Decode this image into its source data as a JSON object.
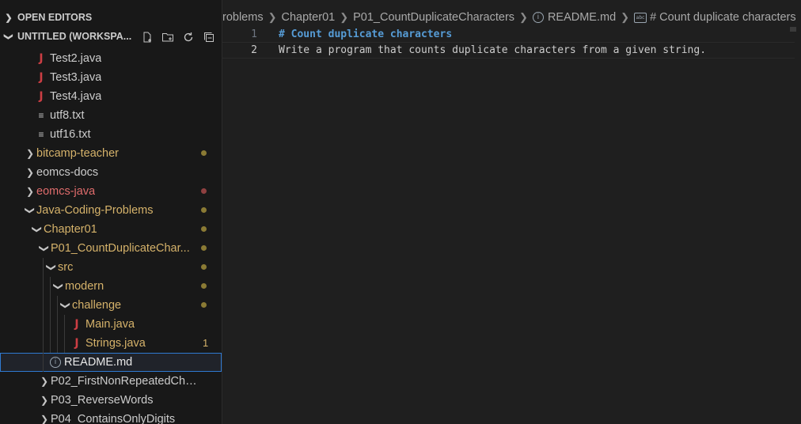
{
  "sidebar": {
    "open_editors_label": "OPEN EDITORS",
    "workspace_label": "UNTITLED (WORKSPA...",
    "items": [
      {
        "label": "Test2.java",
        "icon": "java",
        "indent": 1,
        "color": "plain"
      },
      {
        "label": "Test3.java",
        "icon": "java",
        "indent": 1,
        "color": "plain"
      },
      {
        "label": "Test4.java",
        "icon": "java",
        "indent": 1,
        "color": "plain"
      },
      {
        "label": "utf8.txt",
        "icon": "text",
        "indent": 1,
        "color": "plain"
      },
      {
        "label": "utf16.txt",
        "icon": "text",
        "indent": 1,
        "color": "plain"
      },
      {
        "label": "bitcamp-teacher",
        "icon": "chevron-right",
        "indent": 0,
        "color": "mod",
        "status": "dot"
      },
      {
        "label": "eomcs-docs",
        "icon": "chevron-right",
        "indent": 0,
        "color": "plain"
      },
      {
        "label": "eomcs-java",
        "icon": "chevron-right",
        "indent": 0,
        "color": "err",
        "status": "dot-error"
      },
      {
        "label": "Java-Coding-Problems",
        "icon": "chevron-down",
        "indent": 0,
        "color": "mod",
        "status": "dot"
      },
      {
        "label": "Chapter01",
        "icon": "chevron-down",
        "indent": 1,
        "color": "mod",
        "status": "dot"
      },
      {
        "label": "P01_CountDuplicateChar...",
        "icon": "chevron-down",
        "indent": 2,
        "color": "mod",
        "status": "dot"
      },
      {
        "label": "src",
        "icon": "chevron-down",
        "indent": 3,
        "color": "mod",
        "status": "dot"
      },
      {
        "label": "modern",
        "icon": "chevron-down",
        "indent": 4,
        "color": "mod",
        "status": "dot"
      },
      {
        "label": "challenge",
        "icon": "chevron-down",
        "indent": 5,
        "color": "mod",
        "status": "dot"
      },
      {
        "label": "Main.java",
        "icon": "java",
        "indent": 6,
        "color": "mod"
      },
      {
        "label": "Strings.java",
        "icon": "java",
        "indent": 6,
        "color": "mod",
        "status": "count",
        "count": "1"
      },
      {
        "label": "README.md",
        "icon": "info",
        "indent": 3,
        "color": "plain",
        "selected": true
      },
      {
        "label": "P02_FirstNonRepeatedCharac...",
        "icon": "chevron-right",
        "indent": 2,
        "color": "plain"
      },
      {
        "label": "P03_ReverseWords",
        "icon": "chevron-right",
        "indent": 2,
        "color": "plain"
      },
      {
        "label": "P04_ContainsOnlyDigits",
        "icon": "chevron-right",
        "indent": 2,
        "color": "plain"
      }
    ]
  },
  "breadcrumb": {
    "items": [
      "roblems",
      "Chapter01",
      "P01_CountDuplicateCharacters",
      "README.md",
      "# Count duplicate characters"
    ]
  },
  "editor": {
    "lines": [
      {
        "number": "1",
        "text": "# Count duplicate characters",
        "style": "heading"
      },
      {
        "number": "2",
        "text": "Write a program that counts duplicate characters from a given string.",
        "style": "plain"
      }
    ]
  },
  "colors": {
    "modified": "#d5b26a",
    "error": "#e06c6c",
    "selection_border": "#2f7ad1",
    "heading": "#569cd6"
  }
}
